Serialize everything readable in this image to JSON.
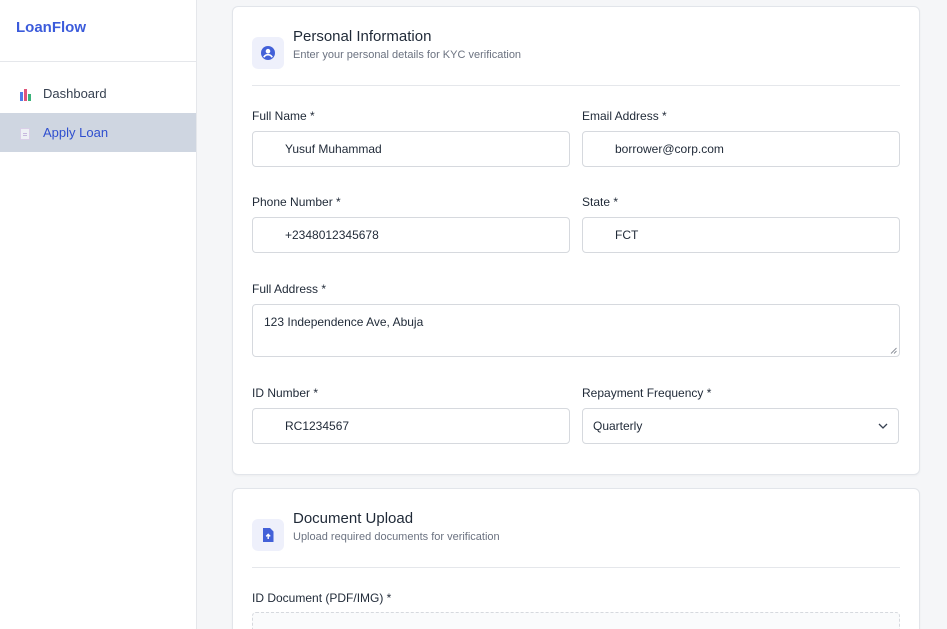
{
  "app": {
    "name": "LoanFlow"
  },
  "sidebar": {
    "items": [
      {
        "label": "Dashboard",
        "icon": "bar-chart-icon",
        "active": false
      },
      {
        "label": "Apply Loan",
        "icon": "document-icon",
        "active": true
      }
    ]
  },
  "personal": {
    "title": "Personal Information",
    "subtitle": "Enter your personal details for KYC verification",
    "icon": "user-circle-icon",
    "fields": {
      "full_name": {
        "label": "Full Name *",
        "value": "Yusuf Muhammad"
      },
      "email": {
        "label": "Email Address *",
        "value": "borrower@corp.com"
      },
      "phone": {
        "label": "Phone Number *",
        "value": "+2348012345678"
      },
      "state": {
        "label": "State *",
        "value": "FCT"
      },
      "address": {
        "label": "Full Address *",
        "value": "123 Independence Ave, Abuja"
      },
      "id_number": {
        "label": "ID Number *",
        "value": "RC1234567"
      },
      "repayment": {
        "label": "Repayment Frequency *",
        "value": "Quarterly"
      }
    }
  },
  "documents": {
    "title": "Document Upload",
    "subtitle": "Upload required documents for verification",
    "icon": "file-upload-icon",
    "id_document_label": "ID Document (PDF/IMG) *"
  },
  "colors": {
    "brand": "#3b5bdb",
    "active_bg": "#cfd6e1",
    "icon_accent": "#4361d8"
  }
}
